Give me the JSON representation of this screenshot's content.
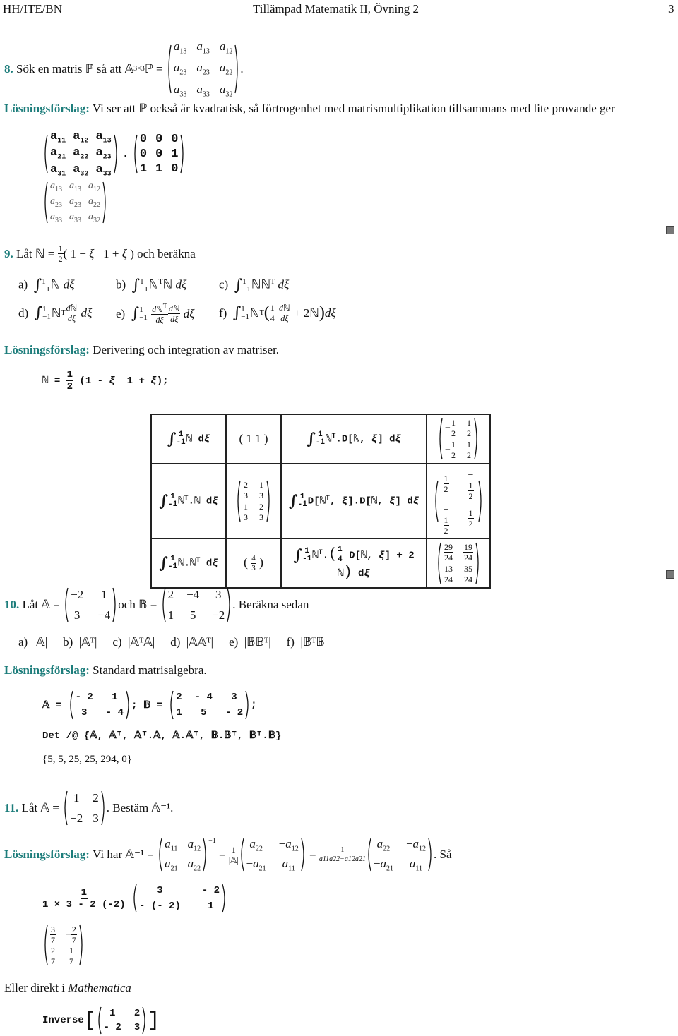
{
  "header": {
    "left": "HH/ITE/BN",
    "center": "Tillämpad Matematik II, Övning 2",
    "page": "3"
  },
  "labels": {
    "solution": "Lösningsförslag:"
  },
  "p8": {
    "num": "8.",
    "text_pre": "Sök en matris ℙ så att 𝔸",
    "subscript": "3×3",
    "text_post": "ℙ =",
    "target": [
      [
        "a13",
        "a13",
        "a12"
      ],
      [
        "a23",
        "a23",
        "a22"
      ],
      [
        "a33",
        "a33",
        "a32"
      ]
    ],
    "solution_text": "Vi ser att ℙ också är kvadratisk, så förtrogenhet med matrismultiplikation tillsammans med lite provande ger",
    "input_left": [
      [
        "a11",
        "a12",
        "a13"
      ],
      [
        "a21",
        "a22",
        "a23"
      ],
      [
        "a31",
        "a32",
        "a33"
      ]
    ],
    "input_right": [
      [
        "0",
        "0",
        "0"
      ],
      [
        "0",
        "0",
        "1"
      ],
      [
        "1",
        "1",
        "0"
      ]
    ],
    "output": [
      [
        "a13",
        "a13",
        "a12"
      ],
      [
        "a23",
        "a23",
        "a22"
      ],
      [
        "a33",
        "a33",
        "a32"
      ]
    ]
  },
  "p9": {
    "num": "9.",
    "text": "Låt ℕ = ½( 1 − ξ   1 + ξ ) och beräkna",
    "items": [
      {
        "label": "a)",
        "expr": "∫₋₁¹ ℕ dξ"
      },
      {
        "label": "b)",
        "expr": "∫₋₁¹ ℕᵀℕ dξ"
      },
      {
        "label": "c)",
        "expr": "∫₋₁¹ ℕℕᵀ dξ"
      },
      {
        "label": "d)",
        "expr": "∫₋₁¹ ℕᵀ dℕ/dξ dξ"
      },
      {
        "label": "e)",
        "expr": "∫₋₁¹ dℕᵀ/dξ dℕ/dξ dξ"
      },
      {
        "label": "f)",
        "expr": "∫₋₁¹ ℕᵀ(¼ dℕ/dξ + 2ℕ) dξ"
      }
    ],
    "solution_text": "Derivering och integration av matriser.",
    "code_def": "ℕ = 1/2 (1 - ξ  1 + ξ);",
    "table": [
      {
        "in1": "∫₋₁¹ℕ dξ",
        "out1": "( 1  1 )",
        "in2": "∫₋₁¹ℕᵀ.D[ℕ, ξ] dξ",
        "out2": [
          [
            "−1/2",
            "1/2"
          ],
          [
            "−1/2",
            "1/2"
          ]
        ]
      },
      {
        "in1": "∫₋₁¹ℕᵀ.ℕ dξ",
        "out1": [
          [
            "2/3",
            "1/3"
          ],
          [
            "1/3",
            "2/3"
          ]
        ],
        "in2": "∫₋₁¹D[ℕᵀ, ξ].D[ℕ, ξ] dξ",
        "out2": [
          [
            "1/2",
            "−1/2"
          ],
          [
            "−1/2",
            "1/2"
          ]
        ]
      },
      {
        "in1": "∫₋₁¹ℕ.ℕᵀ dξ",
        "out1": "( 4/3 )",
        "in2": "∫₋₁¹ℕᵀ.(1/4 D[ℕ, ξ] + 2 ℕ) dξ",
        "out2": [
          [
            "29/24",
            "19/24"
          ],
          [
            "13/24",
            "35/24"
          ]
        ]
      }
    ]
  },
  "p10": {
    "num": "10.",
    "A": [
      [
        "−2",
        "1"
      ],
      [
        "3",
        "−4"
      ]
    ],
    "B": [
      [
        "2",
        "−4",
        "3"
      ],
      [
        "1",
        "5",
        "−2"
      ]
    ],
    "text_mid": "och 𝔹 =",
    "text_post": ". Beräkna sedan",
    "items": [
      {
        "label": "a)",
        "expr": "|𝔸|"
      },
      {
        "label": "b)",
        "expr": "|𝔸ᵀ|"
      },
      {
        "label": "c)",
        "expr": "|𝔸ᵀ𝔸|"
      },
      {
        "label": "d)",
        "expr": "|𝔸𝔸ᵀ|"
      },
      {
        "label": "e)",
        "expr": "|𝔹𝔹ᵀ|"
      },
      {
        "label": "f)",
        "expr": "|𝔹ᵀ𝔹|"
      }
    ],
    "solution_text": "Standard matrisalgebra.",
    "code_A": [
      [
        "- 2",
        "1"
      ],
      [
        "3",
        "- 4"
      ]
    ],
    "code_B": [
      [
        "2",
        "- 4",
        "3"
      ],
      [
        "1",
        "5",
        "- 2"
      ]
    ],
    "code_det": "Det /@ {𝔸, 𝔸ᵀ, 𝔸ᵀ.𝔸, 𝔸.𝔸ᵀ, 𝔹.𝔹ᵀ, 𝔹ᵀ.𝔹}",
    "result": "{5, 5, 25, 25, 294, 0}"
  },
  "p11": {
    "num": "11.",
    "A": [
      [
        "1",
        "2"
      ],
      [
        "−2",
        "3"
      ]
    ],
    "text_post": ". Bestäm 𝔸⁻¹.",
    "solution_pre": "Vi har 𝔸⁻¹ =",
    "general": [
      [
        "a11",
        "a12"
      ],
      [
        "a21",
        "a22"
      ]
    ],
    "adj": [
      [
        "a22",
        "−a12"
      ],
      [
        "−a21",
        "a11"
      ]
    ],
    "det_label": "|𝔸|",
    "det_expr": "a11a22−a12a21",
    "solution_post": ". Så",
    "code_num": "1",
    "code_den": "1 × 3 - 2 (-2)",
    "code_mat": [
      [
        "3",
        "- 2"
      ],
      [
        "- (- 2)",
        "1"
      ]
    ],
    "result": [
      [
        "3/7",
        "−2/7"
      ],
      [
        "2/7",
        "1/7"
      ]
    ],
    "mathematica_text": "Eller direkt i ",
    "mathematica_word": "Mathematica",
    "code_inverse": "Inverse",
    "code_inv_mat": [
      [
        "1",
        "2"
      ],
      [
        "- 2",
        "3"
      ]
    ]
  }
}
